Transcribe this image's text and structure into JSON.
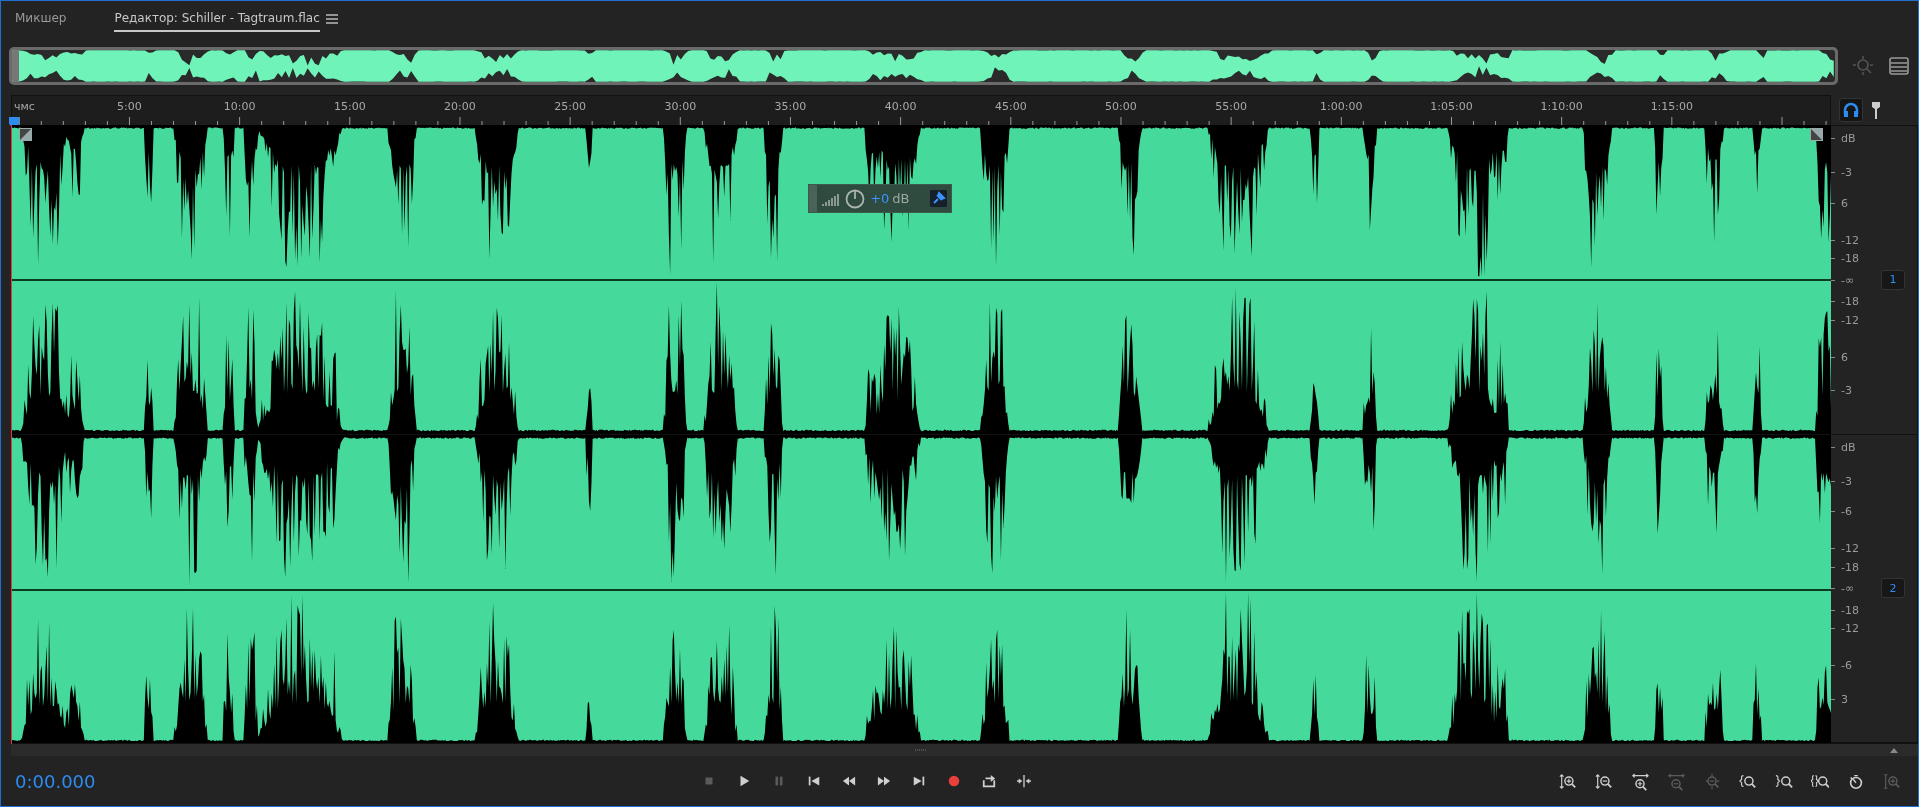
{
  "tabs": [
    {
      "label": "Микшер",
      "selected": false
    },
    {
      "label": "Редактор: Schiller - Tagtraum.flac",
      "selected": true
    }
  ],
  "ruler": {
    "unit": "чмс",
    "labels": [
      "5:00",
      "10:00",
      "15:00",
      "20:00",
      "25:00",
      "30:00",
      "35:00",
      "40:00",
      "45:00",
      "50:00",
      "55:00",
      "1:00:00",
      "1:05:00",
      "1:10:00",
      "1:15:00"
    ]
  },
  "channels": [
    {
      "badge": "1",
      "scale": [
        "dB",
        "-3",
        "6",
        "-12",
        "-18",
        "-∞",
        "-18",
        "-12",
        "6",
        "-3"
      ]
    },
    {
      "badge": "2",
      "scale": [
        "dB",
        "-3",
        "-6",
        "-12",
        "-18",
        "-∞",
        "-18",
        "-12",
        "-6",
        "3"
      ]
    }
  ],
  "hud": {
    "gain_value": "+0",
    "gain_unit": "dB"
  },
  "time": "0:00.000",
  "transport": [
    {
      "kind": "stop",
      "disabled": true
    },
    {
      "kind": "play",
      "disabled": false
    },
    {
      "kind": "pause",
      "disabled": true
    },
    {
      "kind": "to-start",
      "disabled": false
    },
    {
      "kind": "rewind",
      "disabled": false
    },
    {
      "kind": "fast-forward",
      "disabled": false
    },
    {
      "kind": "to-end",
      "disabled": false
    },
    {
      "kind": "record",
      "disabled": false
    },
    {
      "kind": "loop",
      "disabled": false
    },
    {
      "kind": "skip-selection",
      "disabled": false
    }
  ],
  "zoom_tools": [
    {
      "kind": "zoom-in-amplitude",
      "disabled": false
    },
    {
      "kind": "zoom-out-amplitude",
      "disabled": false
    },
    {
      "kind": "zoom-in-time",
      "disabled": false
    },
    {
      "kind": "zoom-out-time",
      "disabled": true
    },
    {
      "kind": "zoom-out-full",
      "disabled": true
    },
    {
      "kind": "zoom-in-start",
      "disabled": false
    },
    {
      "kind": "zoom-in-end",
      "disabled": false
    },
    {
      "kind": "zoom-selection",
      "disabled": false
    },
    {
      "kind": "zoom-to-time",
      "disabled": false
    },
    {
      "kind": "zoom-all-tracks",
      "disabled": true
    }
  ]
}
